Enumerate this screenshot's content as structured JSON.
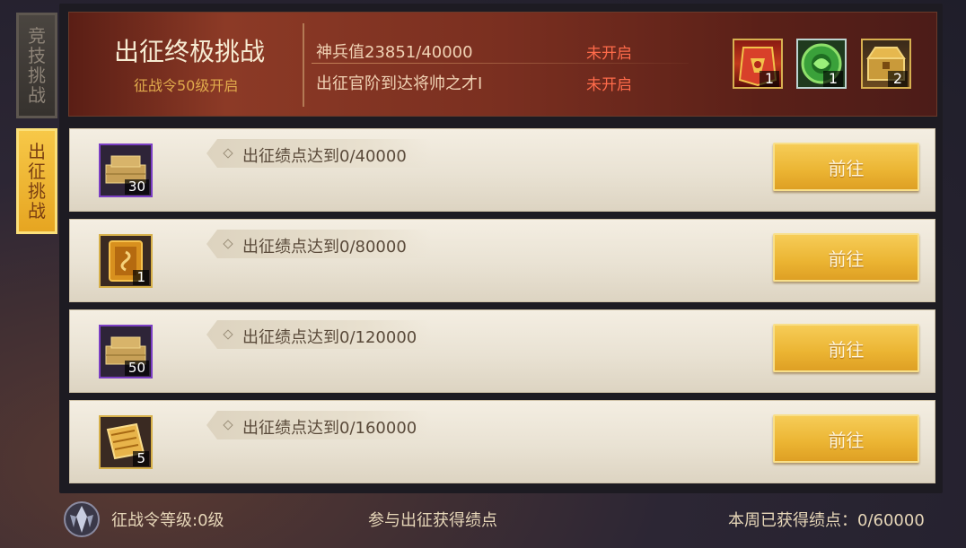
{
  "side_tabs": [
    {
      "label": "竞技挑战",
      "active": false
    },
    {
      "label": "出征挑战",
      "active": true
    }
  ],
  "banner": {
    "title": "出征终极挑战",
    "subtitle": "征战令50级开启",
    "conditions": [
      {
        "text": "神兵值23851/40000",
        "status": "未开启"
      },
      {
        "text": "出征官阶到达将帅之才I",
        "status": "未开启"
      }
    ],
    "rewards": [
      {
        "icon": "red-banner-armor-icon",
        "count": "1"
      },
      {
        "icon": "green-jade-token-icon",
        "count": "1"
      },
      {
        "icon": "gold-treasure-chest-icon",
        "count": "2"
      }
    ]
  },
  "tasks": [
    {
      "label": "出征绩点达到0/40000",
      "reward_icon": "gold-bricks-icon",
      "count": "30",
      "button": "前往"
    },
    {
      "label": "出征绩点达到0/80000",
      "reward_icon": "golden-book-icon",
      "count": "1",
      "button": "前往"
    },
    {
      "label": "出征绩点达到0/120000",
      "reward_icon": "gold-bricks-icon",
      "count": "50",
      "button": "前往"
    },
    {
      "label": "出征绩点达到0/160000",
      "reward_icon": "gold-scroll-pages-icon",
      "count": "5",
      "button": "前往"
    }
  ],
  "footer": {
    "level": "征战令等级:0级",
    "hint": "参与出征获得绩点",
    "weekly": "本周已获得绩点：0/60000"
  },
  "colors": {
    "accent_gold": "#ebb432",
    "status_red": "#ff6b4a",
    "banner_red": "#7a2f20"
  }
}
